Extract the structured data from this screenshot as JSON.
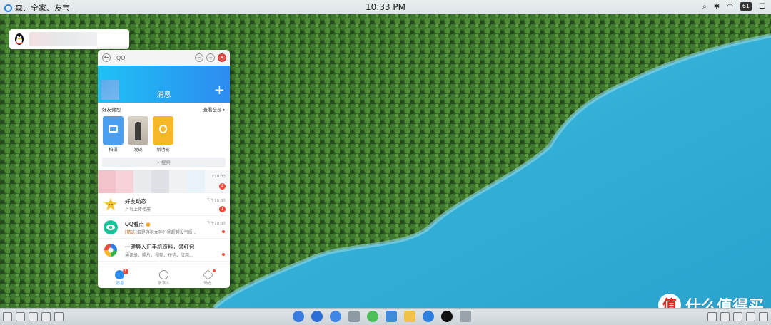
{
  "menubar": {
    "app_title": "森、全家、友宝",
    "clock": "10:33 PM",
    "battery": "61"
  },
  "notification": {
    "icon": "qq-penguin-icon"
  },
  "qq_window": {
    "title": "QQ",
    "back_symbol": "←",
    "header_title": "消息",
    "plus": "+",
    "moments_label": "好友微视",
    "moments_view_all": "查看全部 ▸",
    "moments": [
      {
        "label": "拍摄",
        "kind": "camera"
      },
      {
        "label": "发现",
        "kind": "photo"
      },
      {
        "label": "新功能",
        "kind": "bulb"
      }
    ],
    "search_placeholder": "搜索",
    "conversations": [
      {
        "name": "",
        "sub": "",
        "time": "F10:33",
        "badge": "2",
        "pinned": true
      },
      {
        "name": "好友动态",
        "sub": "乒乓上传相册",
        "time": "下午10:33",
        "badge": "1"
      },
      {
        "name": "QQ看点",
        "sub_tag": "[精选]",
        "sub": "谁是旗袍女神？杨超越没气质...",
        "time": "下午10:33",
        "dot": true
      },
      {
        "name": "一键导入旧手机资料，领红包",
        "sub": "通讯录、照片、视频、短信、应用...",
        "time": "",
        "dot": true
      }
    ],
    "tabs": [
      {
        "label": "消息",
        "badge": "5",
        "active": true
      },
      {
        "label": "联系人"
      },
      {
        "label": "动态",
        "dot": true
      }
    ]
  },
  "watermark": {
    "logo_char": "值",
    "text": "什么值得买"
  },
  "colors": {
    "qq_blue": "#2d8cf0",
    "qq_cyan": "#1ec1f5",
    "badge_red": "#f04b3a",
    "close_red": "#e5504b"
  }
}
